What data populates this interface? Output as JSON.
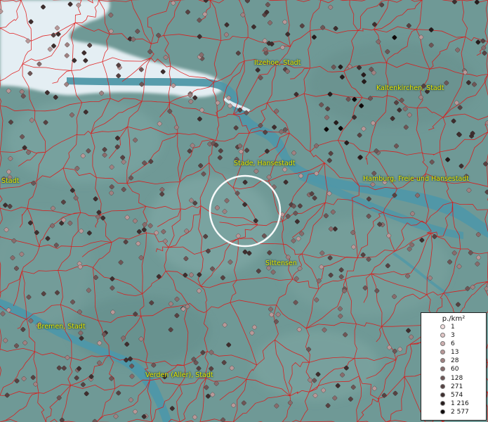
{
  "labels": [
    {
      "id": "itzehoe",
      "text": "Itzehoe, Stadt"
    },
    {
      "id": "kaltenkirchen",
      "text": "Kaltenkirchen, Stadt"
    },
    {
      "id": "stade",
      "text": "Stade, Hansestadt"
    },
    {
      "id": "hamburg",
      "text": "Hamburg, Freie und Hansestadt"
    },
    {
      "id": "stadt-west",
      "text": "Stadt"
    },
    {
      "id": "sittensen",
      "text": "Sittensen"
    },
    {
      "id": "bremen",
      "text": "Bremen, Stadt"
    },
    {
      "id": "verden",
      "text": "Verden (Aller), Stadt"
    }
  ],
  "legend": {
    "title": "p./km²",
    "entries": [
      {
        "value": "1",
        "color": "#f2dede"
      },
      {
        "value": "3",
        "color": "#e2c6c6"
      },
      {
        "value": "6",
        "color": "#cfb0b0"
      },
      {
        "value": "13",
        "color": "#b89898"
      },
      {
        "value": "28",
        "color": "#a08282"
      },
      {
        "value": "60",
        "color": "#886c6c"
      },
      {
        "value": "128",
        "color": "#6e5656"
      },
      {
        "value": "271",
        "color": "#574242"
      },
      {
        "value": "574",
        "color": "#3e2e2e"
      },
      {
        "value": "1 216",
        "color": "#261c1c"
      },
      {
        "value": "2 577",
        "color": "#0c0808"
      }
    ]
  },
  "colors": {
    "land": "#6f9996",
    "water": "#4f97a8",
    "sea": "#e4eef3",
    "boundary": "#e01414",
    "label": "#e8e800",
    "ring": "#ffffff"
  },
  "map_features": [
    "elbe-river",
    "weser-river",
    "north-sea-estuary",
    "municipality-boundaries",
    "selection-ring"
  ]
}
